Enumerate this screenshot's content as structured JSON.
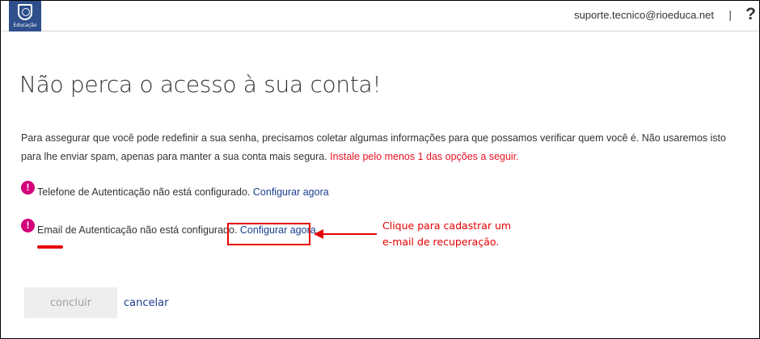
{
  "header": {
    "logo_text": "Educação",
    "user_email": "suporte.tecnico@rioeduca.net",
    "separator": "|",
    "help_label": "?"
  },
  "page": {
    "title": "Não perca o acesso à sua conta!",
    "intro_text": "Para assegurar que você pode redefinir a sua senha, precisamos coletar algumas informações para que possamos verificar quem você é. Não usaremos isto para lhe enviar spam, apenas para manter a sua conta mais segura.",
    "intro_warning": "Instale pelo menos 1 das opções a seguir."
  },
  "items": [
    {
      "status_icon": "!",
      "label": "Telefone de Autenticação não está configurado.",
      "action": "Configurar agora"
    },
    {
      "status_icon": "!",
      "label_highlight": "Email",
      "label_rest": " de Autenticação não está configurado.",
      "action": "Configurar agora"
    }
  ],
  "annotation": {
    "line1": "Clique para cadastrar um",
    "line2": "e-mail de recuperação.",
    "color": "#e60000"
  },
  "buttons": {
    "done_label": "concluir",
    "cancel_label": "cancelar"
  },
  "colors": {
    "alert": "#d2007a",
    "link": "#1a3d8f",
    "warning_text": "#e81123",
    "logo_bg": "#2f4f8c"
  }
}
